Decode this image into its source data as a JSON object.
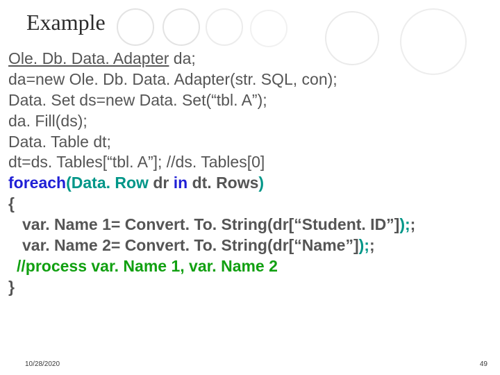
{
  "title": "Example",
  "code": {
    "l1a": "Ole. Db. Data. Adapter",
    "l1b": " da;",
    "l2": "da=new Ole. Db. Data. Adapter(str. SQL, con);",
    "l3": "Data. Set ds=new Data. Set(“tbl. A”);",
    "l4": "da. Fill(ds);",
    "l5": "Data. Table dt;",
    "l6": "dt=ds. Tables[“tbl. A”]; //ds. Tables[0]",
    "l7a": "foreach",
    "l7b": "(",
    "l7c": "Data. Row",
    "l7d": " dr ",
    "l7e": "in",
    "l7f": " dt. Rows",
    "l7g": ")",
    "l8": "{",
    "l9a": "var. Name 1= Convert. To. String(dr[“Student. ID”]",
    "l9b": ");",
    "l10a": "var. Name 2= Convert. To. String(dr[“Name”]",
    "l10b": ");",
    "l11": "//process var. Name 1, var. Name 2",
    "l12": "}"
  },
  "footer": {
    "date": "10/28/2020",
    "page": "49"
  }
}
